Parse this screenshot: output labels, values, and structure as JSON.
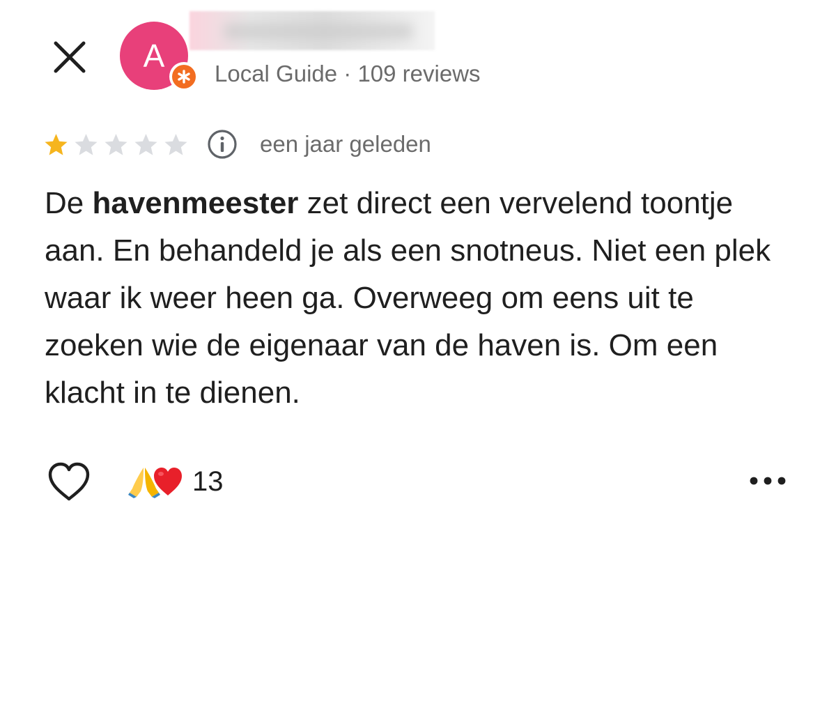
{
  "header": {
    "close_icon": "close-icon",
    "avatar_letter": "A",
    "avatar_color": "#e8407a",
    "badge_color": "#f26d21",
    "meta": "Local Guide · 109 reviews"
  },
  "review": {
    "rating": 1,
    "max_rating": 5,
    "star_color": "#f6b51e",
    "empty_star_color": "#dadce0",
    "time_ago": "een jaar geleden",
    "text_prefix": "De ",
    "text_bold": "havenmeester",
    "text_rest": " zet direct een vervelend toontje aan. En behandeld je als een snotneus. Niet een plek waar ik weer heen ga. Overweeg om eens uit te zoeken wie de eigenaar van de haven is. Om een klacht in te dienen."
  },
  "actions": {
    "like_icon": "heart-outline-icon",
    "reactions": [
      "🙏",
      "❤️"
    ],
    "reaction_count": "13",
    "more_icon": "more-horizontal-icon"
  }
}
